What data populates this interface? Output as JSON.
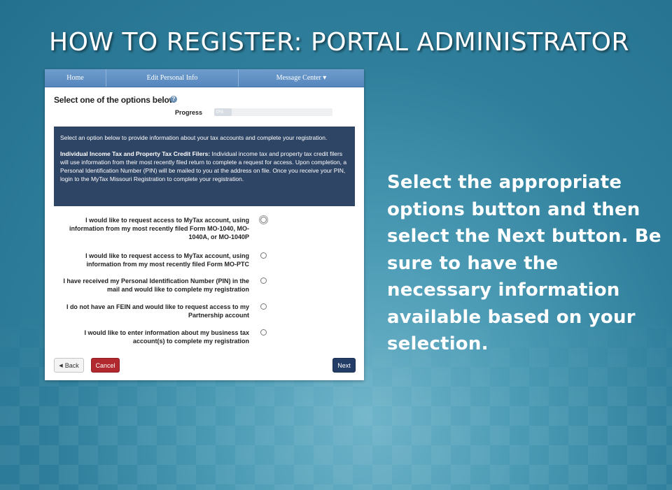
{
  "slide": {
    "title": "HOW TO REGISTER: PORTAL ADMINISTRATOR",
    "instruction": "Select the appropriate options button and then select the Next button. Be sure to have the necessary information available based on your selection."
  },
  "nav": {
    "home": "Home",
    "edit_personal_info": "Edit Personal Info",
    "message_center": "Message Center ▾"
  },
  "form": {
    "heading": "Select one of the options below",
    "help_icon": "?",
    "progress_label": "Progress",
    "progress_text": "0%",
    "progress_value": 0.15,
    "info_paragraph_1": "Select an option below to provide information about your tax accounts and complete your registration.",
    "info_bold": "Individual Income Tax and Property Tax Credit Filers:",
    "info_paragraph_2": " Individual income tax and property tax credit filers will use information from their most recently filed return to complete a request for access. Upon completion, a Personal Identification Number (PIN) will be mailed to you at the address on file. Once you receive your PIN, login to the MyTax Missouri Registration to complete your registration.",
    "options": [
      {
        "label": "I would like to request access to MyTax account, using information from my most recently filed Form MO-1040, MO-1040A, or MO-1040P",
        "selected": false
      },
      {
        "label": "I would like to request access to MyTax account, using information from my most recently filed Form MO-PTC",
        "selected": false
      },
      {
        "label": "I have received my Personal Identification Number (PIN) in the mail and would like to complete my registration",
        "selected": false
      },
      {
        "label": "I do not have an FEIN and would like to request access to my Partnership account",
        "selected": false
      },
      {
        "label": "I would like to enter information about my business tax account(s) to complete my registration",
        "selected": false
      }
    ],
    "back_label": "Back",
    "cancel_label": "Cancel",
    "next_label": "Next"
  },
  "colors": {
    "nav_bar": "#5f8fc4",
    "info_panel": "#2f4565",
    "cancel_button": "#b1282e",
    "next_button": "#233d66"
  }
}
